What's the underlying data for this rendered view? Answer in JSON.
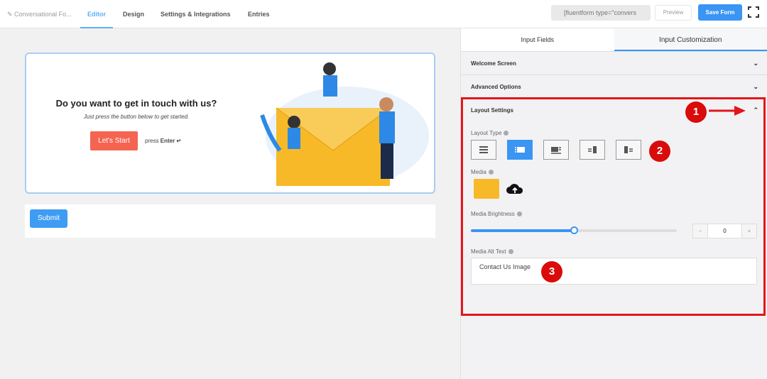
{
  "header": {
    "form_name": "Conversational Fo...",
    "tabs": [
      "Editor",
      "Design",
      "Settings & Integrations",
      "Entries"
    ],
    "shortcode": "[fluentform type=\"convers",
    "preview": "Preview",
    "save": "Save Form"
  },
  "form": {
    "question": "Do you want to get in touch with us?",
    "subtitle": "Just press the button below to get started.",
    "start_button": "Let's Start",
    "press": "press",
    "enter": "Enter ↵",
    "submit": "Submit"
  },
  "panel": {
    "tabs": [
      "Input Fields",
      "Input Customization"
    ],
    "sections": [
      "Welcome Screen",
      "Advanced Options",
      "Layout Settings"
    ],
    "layout_type_label": "Layout Type",
    "media_label": "Media",
    "brightness_label": "Media Brightness",
    "brightness_value": "0",
    "brightness_fraction": 0.5,
    "alt_label": "Media Alt Text",
    "alt_value": "Contact Us Image",
    "stepper_minus": "−",
    "stepper_plus": "+"
  },
  "annotations": [
    "1",
    "2",
    "3"
  ],
  "colors": {
    "accent": "#3a95f3",
    "annotation": "#e3161b",
    "start": "#f46451"
  }
}
